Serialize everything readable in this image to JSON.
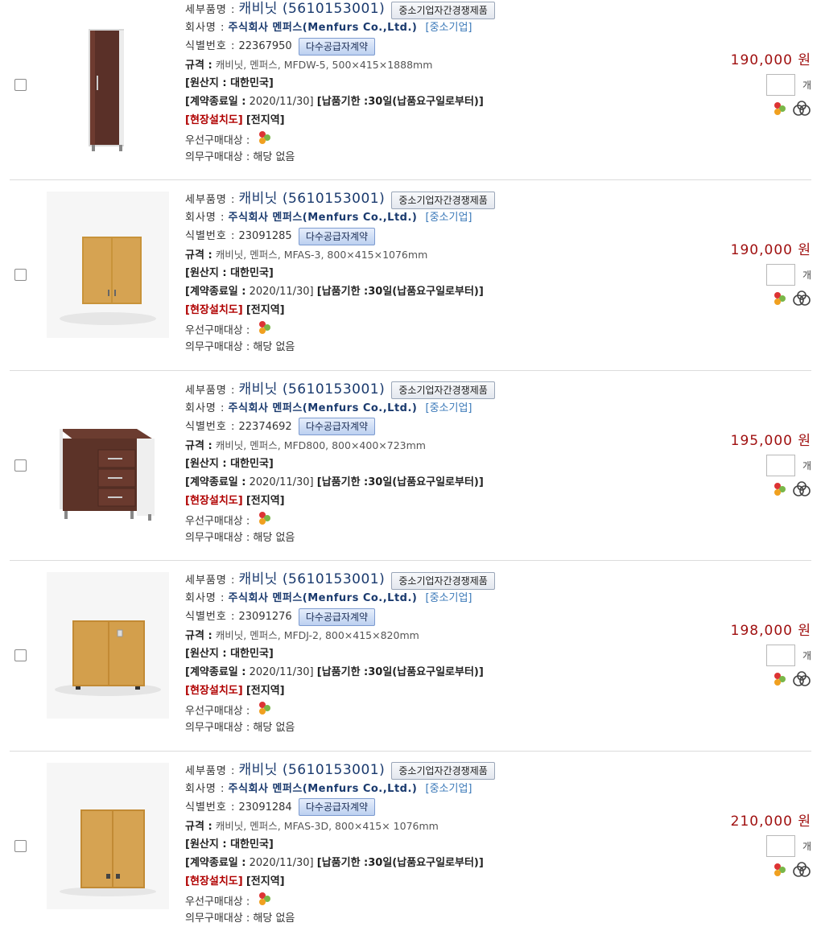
{
  "labels": {
    "detail_name": "세부품명 :",
    "company": "회사명 :",
    "id_no": "식별번호 :",
    "spec": "규격 :",
    "origin": "[원산지 : 대한민국]",
    "contract_end": "[계약종료일 :",
    "delivery": "[납품기한 :30일(납품요구일로부터)]",
    "install": "[현장설치도]",
    "region": "[전지역]",
    "priority": "우선구매대상 :",
    "mandatory": "의무구매대상 : 해당 없음",
    "sme_badge": "중소기업자간경쟁제품",
    "multi_badge": "다수공급자계약",
    "company_name": "주식회사 멘퍼스(Menfurs Co.,Ltd.)",
    "sme_tag": "[중소기업]",
    "unit": "개",
    "contract_date": "2020/11/30]"
  },
  "items": [
    {
      "name": "캐비닛 (5610153001)",
      "id": "22367950",
      "spec": "캐비닛, 멘퍼스, MFDW-5, 500×415×1888mm",
      "price": "190,000 원",
      "image_icon": "tall-cabinet-image"
    },
    {
      "name": "캐비닛 (5610153001)",
      "id": "23091285",
      "spec": "캐비닛, 멘퍼스, MFAS-3, 800×415×1076mm",
      "price": "190,000 원",
      "image_icon": "wall-cabinet-image"
    },
    {
      "name": "캐비닛 (5610153001)",
      "id": "22374692",
      "spec": "캐비닛, 멘퍼스, MFD800, 800×400×723mm",
      "price": "195,000 원",
      "image_icon": "drawer-cabinet-image"
    },
    {
      "name": "캐비닛 (5610153001)",
      "id": "23091276",
      "spec": "캐비닛, 멘퍼스, MFDJ-2, 800×415×820mm",
      "price": "198,000 원",
      "image_icon": "low-cabinet-image"
    },
    {
      "name": "캐비닛 (5610153001)",
      "id": "23091284",
      "spec": "캐비닛, 멘퍼스, MFAS-3D, 800×415× 1076mm",
      "price": "210,000 원",
      "image_icon": "door-cabinet-image"
    }
  ],
  "colors": {
    "price": "#a01010",
    "company": "#1a3a6e",
    "sme_tag": "#3a78b8",
    "install": "#b00000"
  }
}
